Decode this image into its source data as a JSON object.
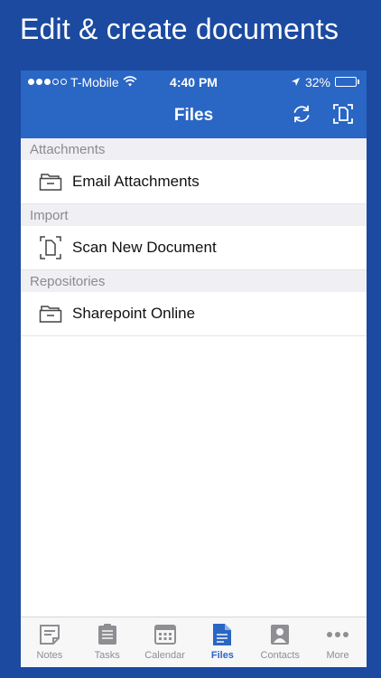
{
  "headline": "Edit & create documents",
  "status_bar": {
    "carrier": "T-Mobile",
    "time": "4:40 PM",
    "battery": "32%",
    "battery_level": 0.32,
    "battery_color": "#f5c518"
  },
  "nav": {
    "title": "Files",
    "refresh_icon": "refresh-icon",
    "scan_icon": "scan-frame-icon"
  },
  "sections": [
    {
      "header": "Attachments",
      "item": "Email Attachments",
      "icon": "folder-tray-icon"
    },
    {
      "header": "Import",
      "item": "Scan New Document",
      "icon": "scan-document-icon"
    },
    {
      "header": "Repositories",
      "item": "Sharepoint Online",
      "icon": "folder-tray-icon"
    }
  ],
  "tabs": [
    {
      "label": "Notes",
      "icon": "notes-icon"
    },
    {
      "label": "Tasks",
      "icon": "tasks-icon"
    },
    {
      "label": "Calendar",
      "icon": "calendar-icon"
    },
    {
      "label": "Files",
      "icon": "files-icon",
      "active": true
    },
    {
      "label": "Contacts",
      "icon": "contacts-icon"
    },
    {
      "label": "More",
      "icon": "more-icon"
    }
  ],
  "colors": {
    "accent": "#2a66c4",
    "background": "#1b4aa0",
    "inactive_tab": "#8e8e93"
  }
}
